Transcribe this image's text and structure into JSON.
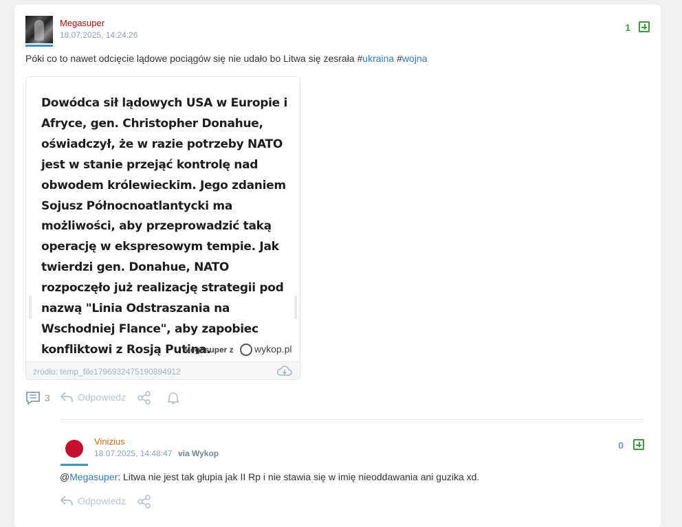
{
  "post": {
    "author": "Megasuper",
    "date": "18.07.2025, 14:24:26",
    "votes": "1",
    "text_prefix": "Póki co to nawet odcięcie lądowe pociągów się nie udało bo Litwa się zesrała #",
    "tag1": "ukraina",
    "hash2": "#",
    "tag2": "wojna",
    "embed": {
      "image_text": "Dowódca sił lądowych USA w Europie i Afryce, gen. Christopher Donahue, oświadczył, że w razie potrzeby NATO jest w stanie przejąć kontrolę nad obwodem królewieckim. Jego zdaniem Sojusz Północnoatlantycki ma możliwości, aby przeprowadzić taką operację w ekspresowym tempie. Jak twierdzi gen. Donahue, NATO rozpoczęło już realizację strategii pod nazwą \"Linia Odstraszania na Wschodniej Flance\", aby zapobiec konfliktowi z Rosją Putina.",
      "watermark_user": "Megasuper z",
      "watermark_site": "wykop.pl",
      "source": "źródło: temp_file1796932475190894912"
    },
    "actions": {
      "comments_count": "3",
      "reply": "Odpowiedz"
    }
  },
  "reply": {
    "author": "Vinizius",
    "date": "18.07.2025, 14:48:47",
    "via": "via Wykop",
    "votes": "0",
    "mention_at": "@",
    "mention": "Megasuper",
    "text": ": Litwa nie jest tak głupia jak II Rp i nie stawia się w imię nieoddawania ani guzika xd.",
    "actions": {
      "reply": "Odpowiedz"
    }
  },
  "icons": [
    "comments-icon",
    "reply-icon",
    "share-icon",
    "bell-icon",
    "plus-icon",
    "cloud-download-icon"
  ],
  "colors": {
    "author": "#a30f0f",
    "author2": "#e26a00",
    "link": "#2e7cb8",
    "vote_positive": "#3d9a3d",
    "muted": "#b7c6d1"
  }
}
